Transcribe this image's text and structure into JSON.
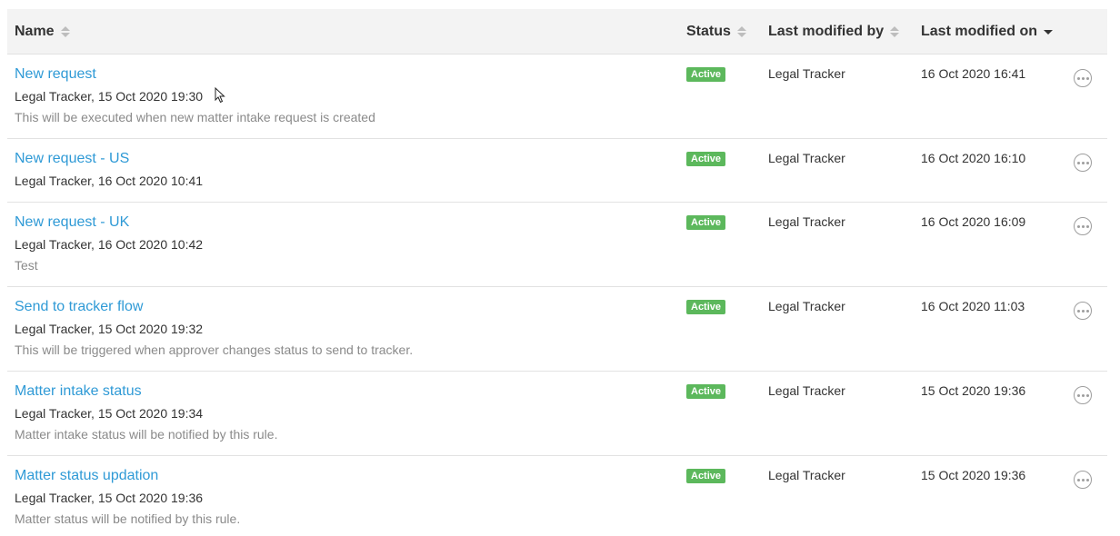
{
  "columns": {
    "name": "Name",
    "status": "Status",
    "last_modified_by": "Last modified by",
    "last_modified_on": "Last modified on"
  },
  "sort": {
    "column": "last_modified_on",
    "direction": "desc"
  },
  "rows": [
    {
      "name": "New request",
      "meta": "Legal Tracker, 15 Oct 2020 19:30",
      "description": "This will be executed when new matter intake request is created",
      "status": "Active",
      "modified_by": "Legal Tracker",
      "modified_on": "16 Oct 2020 16:41"
    },
    {
      "name": "New request - US",
      "meta": "Legal Tracker, 16 Oct 2020 10:41",
      "description": "",
      "status": "Active",
      "modified_by": "Legal Tracker",
      "modified_on": "16 Oct 2020 16:10"
    },
    {
      "name": "New request - UK",
      "meta": "Legal Tracker, 16 Oct 2020 10:42",
      "description": "Test",
      "status": "Active",
      "modified_by": "Legal Tracker",
      "modified_on": "16 Oct 2020 16:09"
    },
    {
      "name": "Send to tracker flow",
      "meta": "Legal Tracker, 15 Oct 2020 19:32",
      "description": "This will be triggered when approver changes status to send to tracker.",
      "status": "Active",
      "modified_by": "Legal Tracker",
      "modified_on": "16 Oct 2020 11:03"
    },
    {
      "name": "Matter intake status",
      "meta": "Legal Tracker, 15 Oct 2020 19:34",
      "description": "Matter intake status will be notified by this rule.",
      "status": "Active",
      "modified_by": "Legal Tracker",
      "modified_on": "15 Oct 2020 19:36"
    },
    {
      "name": "Matter status updation",
      "meta": "Legal Tracker, 15 Oct 2020 19:36",
      "description": "Matter status will be notified by this rule.",
      "status": "Active",
      "modified_by": "Legal Tracker",
      "modified_on": "15 Oct 2020 19:36"
    }
  ],
  "colors": {
    "link": "#2f9ad6",
    "active_badge": "#5cb85c",
    "header_bg": "#f3f3f3"
  },
  "icons": {
    "sort": "sort-icon",
    "sort_desc": "sort-desc-icon",
    "more": "more-options-icon",
    "cursor": "mouse-cursor-icon"
  }
}
